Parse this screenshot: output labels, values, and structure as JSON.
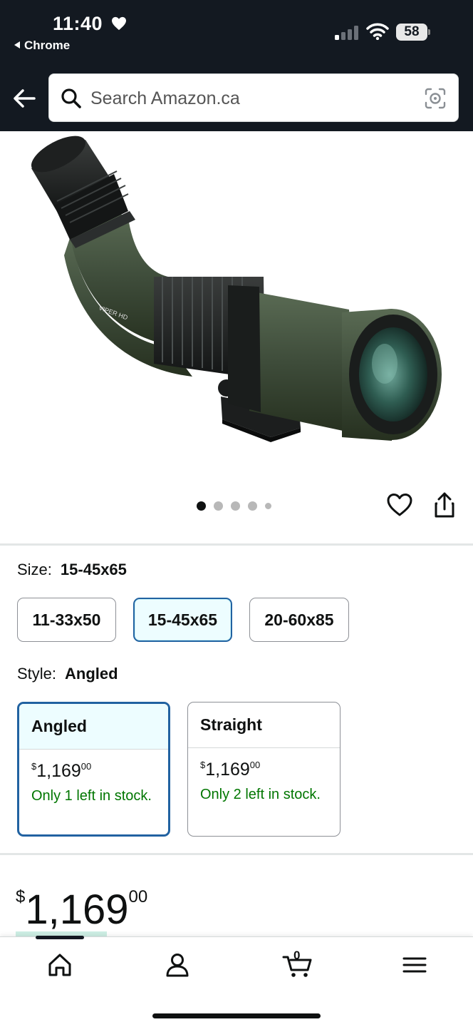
{
  "status_bar": {
    "time": "11:40",
    "back_app": "Chrome",
    "battery": "58"
  },
  "search": {
    "placeholder": "Search Amazon.ca"
  },
  "gallery": {
    "image_count": 5,
    "active_index": 0
  },
  "size": {
    "label": "Size:",
    "selected": "15-45x65",
    "options": [
      "11-33x50",
      "15-45x65",
      "20-60x85"
    ]
  },
  "style": {
    "label": "Style:",
    "selected": "Angled",
    "options": [
      {
        "name": "Angled",
        "currency": "$",
        "whole": "1,169",
        "cents": "00",
        "stock": "Only 1 left in stock."
      },
      {
        "name": "Straight",
        "currency": "$",
        "whole": "1,169",
        "cents": "00",
        "stock": "Only 2 left in stock."
      }
    ]
  },
  "price": {
    "currency": "$",
    "whole": "1,169",
    "cents": "00"
  },
  "bottom_nav": {
    "cart_count": "0"
  },
  "colors": {
    "header_bg": "#131921",
    "selected_border": "#2162a1",
    "stock_green": "#007600"
  }
}
